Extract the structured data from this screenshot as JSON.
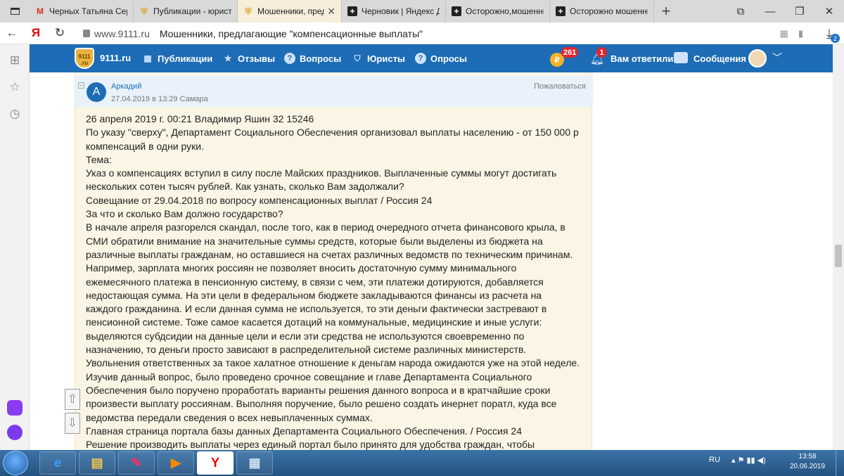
{
  "browser": {
    "tabs": [
      {
        "title": "Черных Татьяна Серг",
        "icon": "gmail-icon",
        "active": false
      },
      {
        "title": "Публикации - юрист",
        "icon": "9111-shield-icon",
        "active": false
      },
      {
        "title": "Мошенники, пред",
        "icon": "9111-shield-icon",
        "active": true
      },
      {
        "title": "Черновик | Яндекс Д",
        "icon": "plus-square-icon",
        "active": false
      },
      {
        "title": "Осторожно,мошенни",
        "icon": "plus-square-icon",
        "active": false
      },
      {
        "title": "Осторожно мошенни",
        "icon": "plus-square-icon",
        "active": false
      }
    ],
    "address": {
      "host": "www.9111.ru",
      "page_title": "Мошенники, предлагающие \"компенсационные выплаты\"",
      "download_badge": "2"
    }
  },
  "site": {
    "logo_text": "9111 .ru",
    "name": "9111.ru",
    "nav": [
      {
        "label": "Публикации",
        "icon": "building-icon"
      },
      {
        "label": "Отзывы",
        "icon": "star-icon"
      },
      {
        "label": "Вопросы",
        "icon": "question-icon"
      },
      {
        "label": "Юристы",
        "icon": "shield-icon"
      },
      {
        "label": "Опросы",
        "icon": "question-icon"
      }
    ],
    "coin_symbol": "₽",
    "coin_badge": "261",
    "notif_badge": "1",
    "notif_label": "Вам ответили",
    "messages_label": "Сообщения"
  },
  "post": {
    "author": "Аркадий",
    "avatar_letter": "А",
    "date": "27.04.2019 в 13:29",
    "city": "Самара",
    "complain": "Пожаловаться",
    "lines": [
      "26 апреля 2019 г. 00:21 Владимир Яшин 32 15246",
      "По указу \"сверху\", Департамент Социального Обеспечения организовал выплаты населению - от 150 000 р",
      "компенсаций в одни руки.",
      "Тема:",
      "Указ о компенсациях вступил в силу после Майских праздников. Выплаченные суммы могут достигать",
      "нескольких сотен тысяч рублей. Как узнать, сколько Вам задолжали?",
      "Совещание от 29.04.2018 по вопросу компенсационных выплат / Россия 24",
      "За что и сколько Вам должно государство?",
      "В начале апреля разгорелся скандал, после того, как в период очередного отчета финансового крыла, в",
      "СМИ обратили внимание на значительные суммы средств, которые были выделены из бюджета на",
      "различные выплаты гражданам, но оставшиеся на счетах различных ведомств по техническим причинам.",
      "Например, зарплата многих россиян не позволяет вносить достаточную сумму минимального",
      "ежемесячного платежа в пенсионную систему, в связи с чем, эти платежи дотируются, добавляется",
      "недостающая сумма. На эти цели в федеральном бюджете закладываются финансы из расчета на",
      "каждого гражданина. И если данная сумма не используется, то эти деньги фактически застревают в",
      "пенсионной системе. Тоже самое касается дотаций на коммунальные, медицинские и иные услуги:",
      "выделяются субдсидии на данные цели и если эти средства не используются своевременно по",
      "назначению, то деньги просто зависают в распределительной системе различных министерств.",
      "Увольнения ответственных за такое халатное отношение к деньгам народа ожидаются уже на этой неделе.",
      "Изучив данный вопрос, было проведено срочное совещание и главе Департамента Социального",
      "Обеспечения было поручено проработать варианты решения данного вопроса и в кратчайшие сроки",
      "произвести выплату россиянам. Выполняя поручение, было решено создать инернет поратл, куда все",
      "ведомства передали сведения о всех невыплаченных суммах.",
      "Главная страница портала базы данных Департамента Социального Обеспечения. / Россия 24",
      "Решение производить выплаты через единый портал было принято для удобства граждан, чтобы"
    ]
  },
  "taskbar": {
    "apps": [
      "ie-icon",
      "explorer-icon",
      "paint-icon",
      "media-player-icon",
      "yandex-browser-icon",
      "calculator-icon"
    ],
    "lang": "RU",
    "time": "13:58",
    "date": "20.06.2019"
  }
}
